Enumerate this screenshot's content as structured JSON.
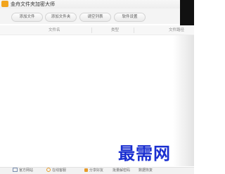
{
  "app": {
    "title": "金舟文件夹加密大师"
  },
  "toolbar": {
    "buttons": [
      "添加文件",
      "添加文件夹",
      "请空列表",
      "软件设置"
    ]
  },
  "file_table": {
    "columns": [
      "文件名",
      "类型",
      "文件路径"
    ],
    "rows": []
  },
  "watermark": {
    "text": "最需网"
  },
  "status_bar": {
    "items": [
      "官方网站",
      "在线客服",
      "分享好友",
      "批量解密码",
      "数据恢复"
    ]
  }
}
